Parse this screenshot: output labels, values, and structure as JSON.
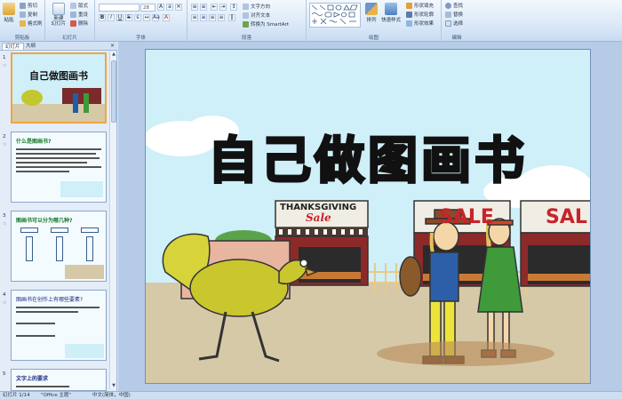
{
  "ribbon": {
    "clipboard": {
      "label": "剪贴板",
      "paste": "粘贴",
      "cut": "剪切",
      "copy": "复制",
      "format_painter": "格式刷"
    },
    "slides": {
      "label": "幻灯片",
      "new_slide": "新建\n幻灯片",
      "layout": "版式",
      "reset": "重设",
      "delete": "删除"
    },
    "font": {
      "label": "字体",
      "font_size": "28"
    },
    "paragraph": {
      "label": "段落",
      "text_direction": "文字方向",
      "align_text": "对齐文本",
      "smartart": "转换为 SmartArt"
    },
    "drawing": {
      "label": "绘图",
      "arrange": "排列",
      "quick_styles": "快速样式",
      "shape_fill": "形状填充",
      "shape_outline": "形状轮廓",
      "shape_effects": "形状效果"
    },
    "editing": {
      "label": "编辑",
      "find": "查找",
      "replace": "替换",
      "select": "选择"
    }
  },
  "panel": {
    "tabs": [
      "幻灯片",
      "大纲"
    ],
    "close": "×",
    "thumbnails": [
      {
        "num": "1",
        "title": "自己做图画书",
        "selected": true
      },
      {
        "num": "2",
        "title": "什么是图画书?"
      },
      {
        "num": "3",
        "title": "图画书可以分为哪几种?"
      },
      {
        "num": "4",
        "title": "图画书在创作上有哪些要素?"
      },
      {
        "num": "5",
        "title": "文字上的要求"
      }
    ]
  },
  "slide": {
    "title": "自己做图画书",
    "sign_store1": "THANKSGIVING",
    "sign_store1_sale": "Sale",
    "sign_store2": "SALE",
    "sign_store3": "SAL",
    "colors": {
      "sky": "#cfeff9",
      "ground": "#d6c9a8",
      "title": "#111111"
    }
  },
  "status": {
    "slide_info": "幻灯片 1/14",
    "theme": "\"Office 主题\"",
    "language": "中文(简体，中国)"
  }
}
